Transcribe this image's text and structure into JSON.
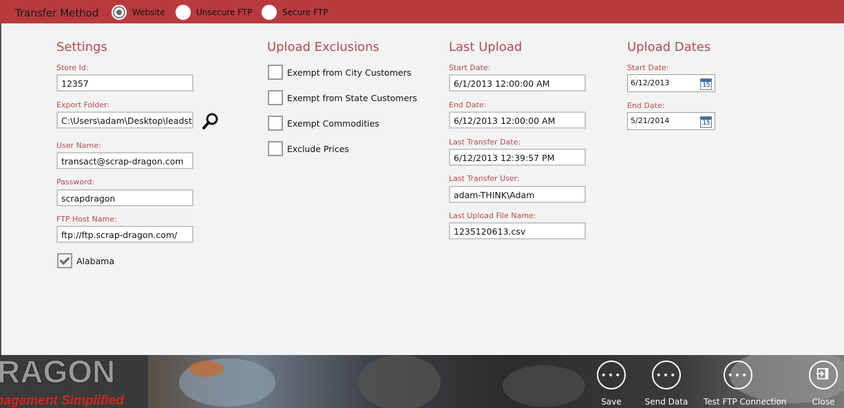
{
  "topbar": {
    "title": "Transfer Method",
    "options": [
      {
        "label": "Website",
        "checked": true
      },
      {
        "label": "Unsecure FTP",
        "checked": false
      },
      {
        "label": "Secure FTP",
        "checked": false
      }
    ]
  },
  "settings": {
    "heading": "Settings",
    "store_id_label": "Store Id:",
    "store_id": "12357",
    "export_folder_label": "Export Folder:",
    "export_folder": "C:\\Users\\adam\\Desktop\\leadsteps",
    "user_name_label": "User Name:",
    "user_name": "transact@scrap-dragon.com",
    "password_label": "Password:",
    "password": "scrapdragon",
    "ftp_host_label": "FTP Host Name:",
    "ftp_host": "ftp://ftp.scrap-dragon.com/",
    "state_label": "Alabama",
    "state_checked": true
  },
  "exclusions": {
    "heading": "Upload Exclusions",
    "items": [
      {
        "label": "Exempt from City Customers",
        "checked": false
      },
      {
        "label": "Exempt from State Customers",
        "checked": false
      },
      {
        "label": "Exempt Commodities",
        "checked": false
      },
      {
        "label": "Exclude Prices",
        "checked": false
      }
    ]
  },
  "last_upload": {
    "heading": "Last Upload",
    "start_label": "Start Date:",
    "start": "6/1/2013 12:00:00 AM",
    "end_label": "End Date:",
    "end": "6/12/2013 12:00:00 AM",
    "transfer_date_label": "Last Transfer Date:",
    "transfer_date": "6/12/2013 12:39:57 PM",
    "transfer_user_label": "Last Transfer User:",
    "transfer_user": "adam-THINK\\Adam",
    "file_name_label": "Last Upload File Name:",
    "file_name": "1235120613.csv"
  },
  "upload_dates": {
    "heading": "Upload Dates",
    "start_label": "Start Date:",
    "start": "6/12/2013",
    "end_label": "End Date:",
    "end": "5/21/2014",
    "calendar_day": "15"
  },
  "appbar": {
    "banner_text_top": "RAGON",
    "banner_text_bottom": "nagement Simplified",
    "buttons": [
      {
        "label": "Save",
        "icon": "more-icon"
      },
      {
        "label": "Send Data",
        "icon": "more-icon"
      },
      {
        "label": "Test FTP Connection",
        "icon": "more-icon"
      },
      {
        "label": "Close",
        "icon": "exit-icon"
      }
    ]
  },
  "colors": {
    "accent": "#b83a3e",
    "label_red": "#b54a4a"
  }
}
